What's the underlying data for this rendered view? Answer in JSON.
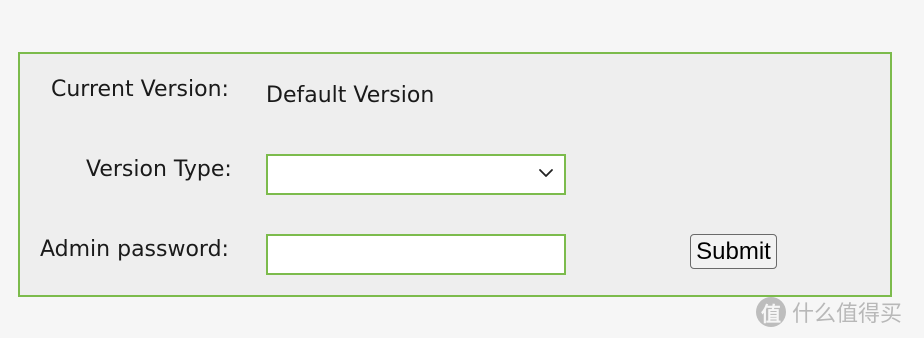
{
  "form": {
    "current_version_label": "Current Version:",
    "current_version_value": "Default Version",
    "version_type_label": "Version Type:",
    "version_type_selected": "",
    "admin_password_label": "Admin password:",
    "admin_password_value": "",
    "submit_label": "Submit"
  },
  "watermark": {
    "logo_glyph": "值",
    "text": "什么值得买"
  },
  "colors": {
    "accent_border": "#7cbb4c",
    "panel_bg": "#eeeeee",
    "page_bg": "#f6f6f6"
  },
  "icons": {
    "select_arrow": "chevron-down-icon"
  }
}
